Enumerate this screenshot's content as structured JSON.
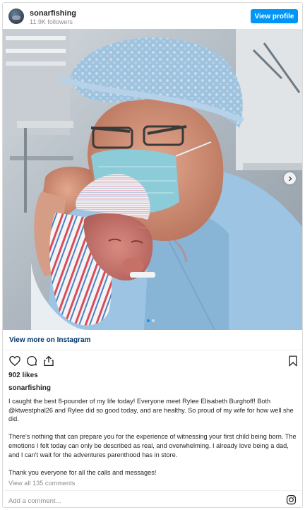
{
  "post": {
    "username": "sonarfishing",
    "followers": "11.9K followers",
    "view_profile_label": "View profile",
    "view_more_label": "View more on Instagram",
    "likes": "902 likes",
    "caption_username": "sonarfishing",
    "caption_paragraphs": [
      "I caught the best 8-pounder of my life today! Everyone meet Rylee Elisabeth Burghoff! Both @ktwestphal26 and Rylee did so good today, and are healthy. So proud of my wife for how well she did.",
      "There's nothing that can prepare you for the experience of witnessing your first child being born. The emotions I felt today can only be described as real, and overwhelming. I already love being a dad, and I can't wait for the adventures parenthood has in store.",
      "Thank you everyone for all the calls and messages!"
    ],
    "view_comments": "View all 135 comments",
    "add_comment_placeholder": "Add a comment..."
  },
  "carousel": {
    "current": 1,
    "total": 2
  },
  "icons": {
    "like": "heart-icon",
    "comment": "comment-icon",
    "share": "share-icon",
    "save": "bookmark-icon",
    "brand": "instagram-icon",
    "next": "chevron-right-icon"
  },
  "colors": {
    "accent": "#0095f6",
    "link": "#00376b",
    "text": "#262626",
    "muted": "#8e8e8e"
  }
}
